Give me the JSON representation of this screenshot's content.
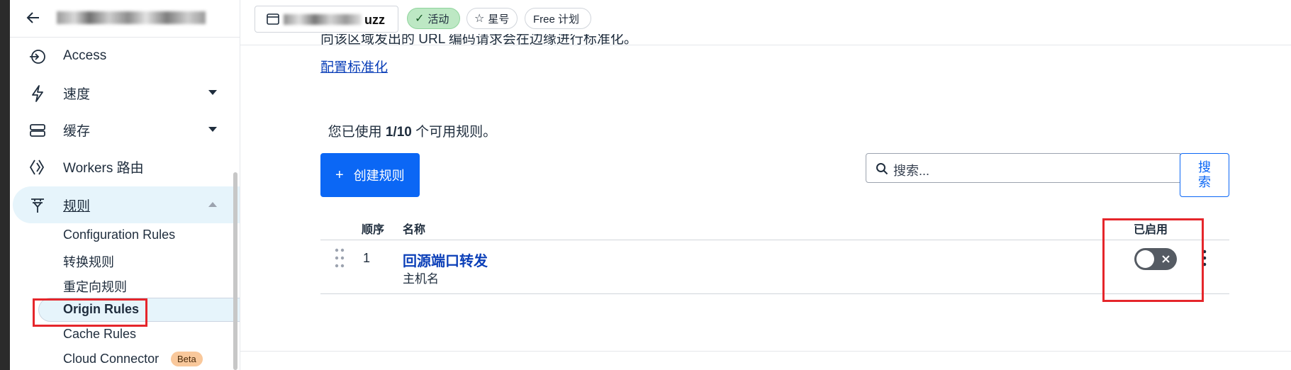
{
  "sidebar": {
    "back_icon": "arrow-left-icon",
    "items": [
      {
        "label": "Access",
        "icon": "access-icon"
      },
      {
        "label": "速度",
        "icon": "lightning-icon"
      },
      {
        "label": "缓存",
        "icon": "storage-icon"
      },
      {
        "label": "Workers 路由",
        "icon": "workers-icon"
      },
      {
        "label": "规则",
        "icon": "rules-funnel-icon"
      }
    ],
    "sub_items": [
      {
        "label": "Configuration Rules"
      },
      {
        "label": "转换规则"
      },
      {
        "label": "重定向规则"
      },
      {
        "label": "Origin Rules"
      },
      {
        "label": "Cache Rules"
      },
      {
        "label": "Cloud Connector",
        "badge": "Beta"
      }
    ]
  },
  "topbar": {
    "domain_suffix": "uzz",
    "status_badge": "活动",
    "star_label": "星号",
    "plan_label": "Free 计划"
  },
  "content": {
    "partial_text": "向该区域发出的 URL 编码请求会在边缘进行标准化。",
    "configure_link": "配置标准化",
    "usage_prefix": "您已使用 ",
    "usage_count": "1/10",
    "usage_suffix": " 个可用规则。",
    "create_button": "创建规则",
    "search_placeholder": "搜索...",
    "search_button": "搜索",
    "table": {
      "headers": {
        "order": "顺序",
        "name": "名称",
        "enabled": "已启用"
      },
      "rows": [
        {
          "order": "1",
          "name": "回源端口转发",
          "subtitle": "主机名",
          "enabled": false
        }
      ]
    }
  },
  "colors": {
    "primary": "#0b67f5",
    "link": "#0b3fb8",
    "active_bg": "#e6f4fb",
    "status_green_bg": "#bde8c4",
    "beta_bg": "#f9c89b",
    "highlight_red": "#e5262b"
  }
}
